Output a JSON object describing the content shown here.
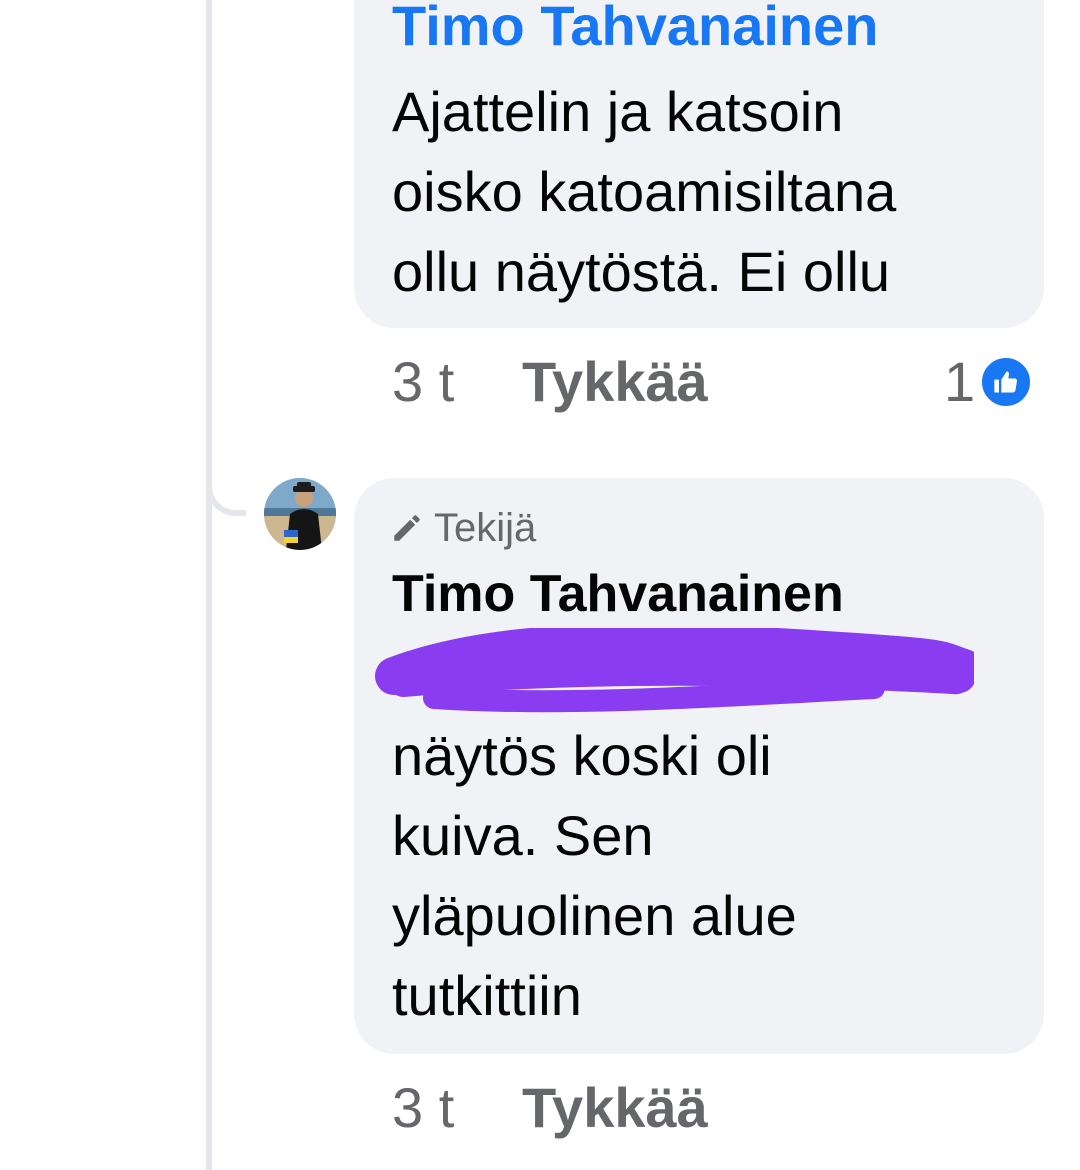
{
  "comments": [
    {
      "author": "Timo Tahvanainen",
      "text": "Ajattelin ja katsoin\noisko katoamisiltana\nollu näytöstä. Ei ollu",
      "time": "3 t",
      "like_label": "Tykkää",
      "reaction_count": "1",
      "reaction_icon": "like-icon"
    },
    {
      "badge_icon": "pencil-icon",
      "badge": "Tekijä",
      "author": "Timo Tahvanainen",
      "text": "näytös koski oli\nkuiva. Sen\nyläpuolinen alue\ntutkittiin",
      "time": "3 t",
      "like_label": "Tykkää"
    }
  ],
  "colors": {
    "link_blue": "#1877f2",
    "bubble_bg": "#f0f2f5",
    "muted_text": "#65676b",
    "redaction_purple": "#8a3cf0"
  }
}
